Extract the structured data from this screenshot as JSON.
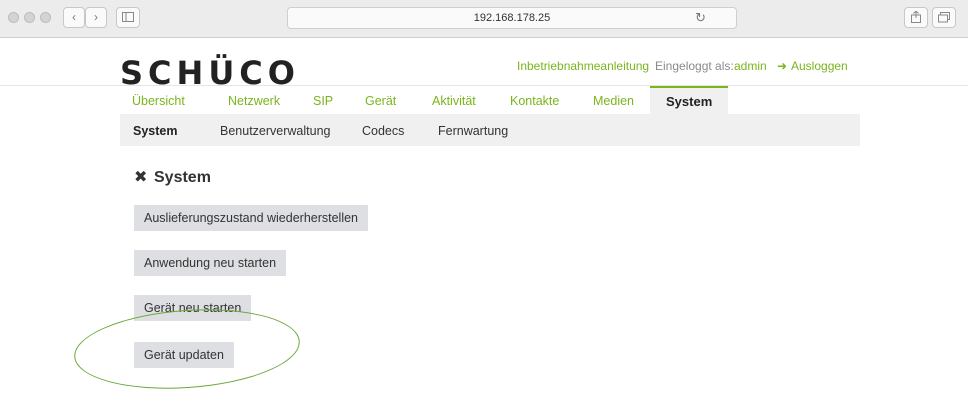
{
  "browser": {
    "url": "192.168.178.25",
    "reload_icon": "↻",
    "back_icon": "‹",
    "forward_icon": "›"
  },
  "header": {
    "logo": "SCHÜCO",
    "commissioning_link": "Inbetriebnahmeanleitung",
    "logged_in_label": "Eingeloggt als:",
    "username": "admin",
    "logout_icon": "➜",
    "logout_label": "Ausloggen"
  },
  "main_nav": [
    {
      "label": "Übersicht"
    },
    {
      "label": "Netzwerk"
    },
    {
      "label": "SIP"
    },
    {
      "label": "Gerät"
    },
    {
      "label": "Aktivität"
    },
    {
      "label": "Kontakte"
    },
    {
      "label": "Medien"
    },
    {
      "label": "System",
      "active": true
    }
  ],
  "sub_nav": [
    {
      "label": "System",
      "active": true
    },
    {
      "label": "Benutzerverwaltung"
    },
    {
      "label": "Codecs"
    },
    {
      "label": "Fernwartung"
    }
  ],
  "content": {
    "title_icon": "✖",
    "title": "System",
    "buttons": [
      {
        "label": "Auslieferungszustand wiederherstellen"
      },
      {
        "label": "Anwendung neu starten"
      },
      {
        "label": "Gerät neu starten"
      },
      {
        "label": "Gerät updaten"
      }
    ]
  },
  "colors": {
    "accent": "#7ab51d",
    "button_bg": "#dedfe2",
    "nav_bg": "#f0f0f0",
    "annotation": "#6aa83a"
  }
}
